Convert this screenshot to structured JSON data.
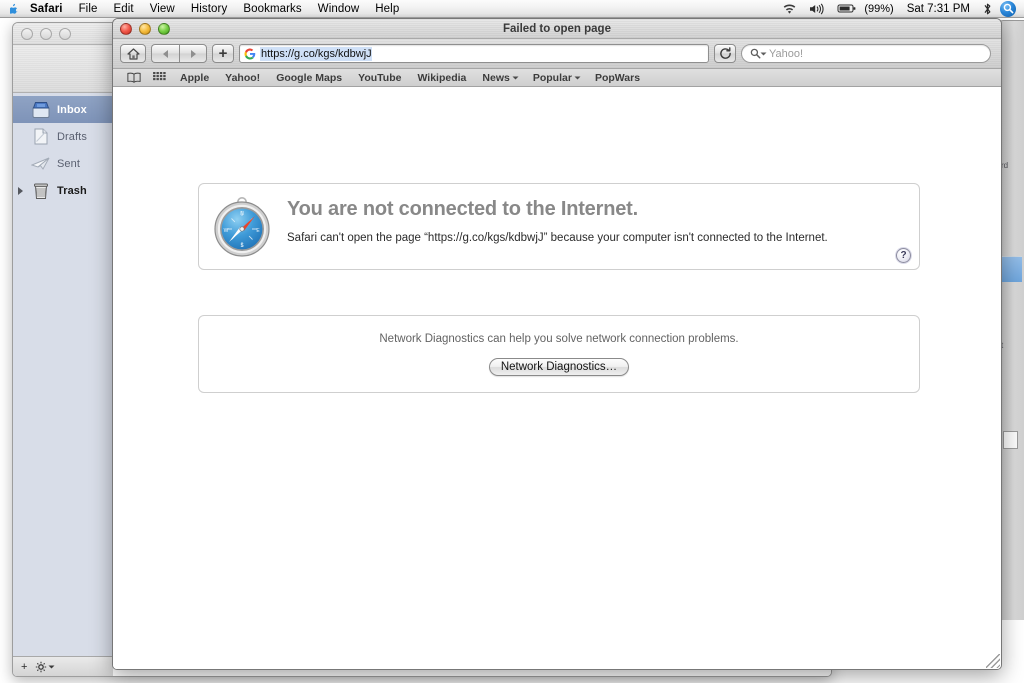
{
  "menubar": {
    "apple_icon": "apple-logo-icon",
    "items": [
      {
        "label": "Safari",
        "bold": true
      },
      {
        "label": "File",
        "bold": false
      },
      {
        "label": "Edit",
        "bold": false
      },
      {
        "label": "View",
        "bold": false
      },
      {
        "label": "History",
        "bold": false
      },
      {
        "label": "Bookmarks",
        "bold": false
      },
      {
        "label": "Window",
        "bold": false
      },
      {
        "label": "Help",
        "bold": false
      }
    ],
    "status": {
      "wifi_icon": "wifi-icon",
      "volume_icon": "volume-icon",
      "battery_icon": "battery-icon",
      "battery_percent": "(99%)",
      "clock": "Sat 7:31 PM",
      "bluetooth_icon": "bluetooth-icon",
      "spotlight_icon": "spotlight-search-icon"
    }
  },
  "mail_window": {
    "sidebar": {
      "mailboxes": [
        {
          "label": "Inbox",
          "icon": "inbox-tray-icon",
          "selected": true,
          "disclosure": false
        },
        {
          "label": "Drafts",
          "icon": "drafts-page-icon",
          "selected": false,
          "disclosure": false
        },
        {
          "label": "Sent",
          "icon": "sent-plane-icon",
          "selected": false,
          "disclosure": false
        },
        {
          "label": "Trash",
          "icon": "trash-can-icon",
          "selected": false,
          "disclosure": true
        }
      ],
      "add_mailbox_label": "+",
      "action_menu_label": "⚙"
    }
  },
  "safari": {
    "title": "Failed to open page",
    "toolbar": {
      "home_icon": "home-icon",
      "back_icon": "back-arrow-icon",
      "forward_icon": "forward-arrow-icon",
      "add_bookmark_label": "+",
      "url": "https://g.co/kgs/kdbwjJ",
      "site_favicon": "google-g-favicon",
      "reload_icon": "reload-icon",
      "search_icon": "magnifier-icon",
      "search_placeholder": "Yahoo!",
      "search_value": ""
    },
    "bookmarks_bar": {
      "show_all_icon": "bookmarks-book-icon",
      "top_sites_icon": "top-sites-grid-icon",
      "items": [
        {
          "label": "Apple",
          "menu": false
        },
        {
          "label": "Yahoo!",
          "menu": false
        },
        {
          "label": "Google Maps",
          "menu": false
        },
        {
          "label": "YouTube",
          "menu": false
        },
        {
          "label": "Wikipedia",
          "menu": false
        },
        {
          "label": "News",
          "menu": true
        },
        {
          "label": "Popular",
          "menu": true
        },
        {
          "label": "PopWars",
          "menu": false
        }
      ]
    },
    "error_page": {
      "safari_icon": "safari-compass-icon",
      "heading": "You are not connected to the Internet.",
      "subtext": "Safari can't open the page “https://g.co/kgs/kdbwjJ” because your computer isn't connected to the Internet.",
      "help_label": "?",
      "diagnostics_text": "Network Diagnostics can help you solve network connection problems.",
      "diagnostics_button": "Network Diagnostics…"
    }
  },
  "colors": {
    "selection_blue": "#7e93b8",
    "url_highlight": "#cfe0f7",
    "heading_gray": "#888888",
    "desktop": "#ffffff"
  }
}
